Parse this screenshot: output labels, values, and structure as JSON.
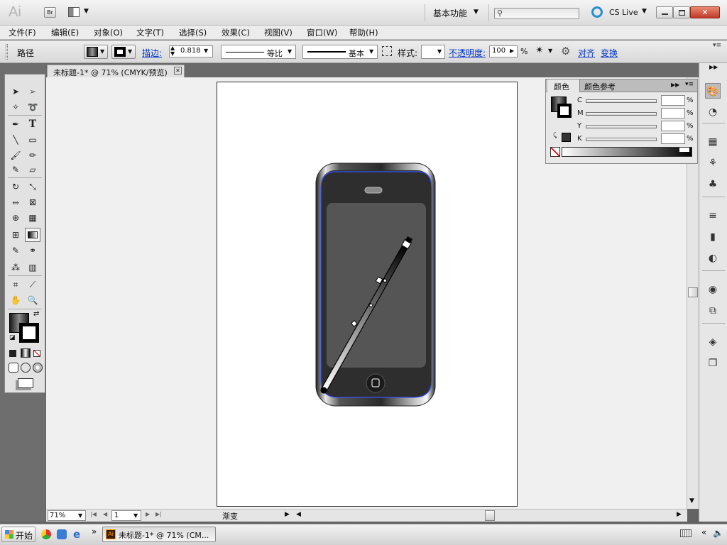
{
  "app": {
    "logo": "Ai",
    "bridge": "Br",
    "workspace": "基本功能",
    "cslive": "CS Live",
    "search_value": ""
  },
  "menu": [
    "文件(F)",
    "编辑(E)",
    "对象(O)",
    "文字(T)",
    "选择(S)",
    "效果(C)",
    "视图(V)",
    "窗口(W)",
    "帮助(H)"
  ],
  "control": {
    "selection_label": "路径",
    "stroke_label": "描边:",
    "stroke_value": "0.818",
    "stroke_profile": "等比",
    "brush": "基本",
    "style_label": "样式:",
    "opacity_label": "不透明度:",
    "opacity_value": "100",
    "opacity_unit": "%",
    "align": "对齐",
    "transform": "变换"
  },
  "document": {
    "tab_title": "未标题-1* @ 71% (CMYK/预览)"
  },
  "status": {
    "zoom": "71%",
    "artboard": "1",
    "info": "渐变"
  },
  "color_panel": {
    "tab_color": "颜色",
    "tab_guide": "颜色参考",
    "channels": [
      {
        "label": "C",
        "value": "",
        "unit": "%"
      },
      {
        "label": "M",
        "value": "",
        "unit": "%"
      },
      {
        "label": "Y",
        "value": "",
        "unit": "%"
      },
      {
        "label": "K",
        "value": "",
        "unit": "%"
      }
    ]
  },
  "taskbar": {
    "start": "开始",
    "app_button": "未标题-1* @ 71% (CM..."
  },
  "colors": {
    "accent": "#0033cc",
    "panel_dark": "#636363",
    "selection_blue": "#3355ff"
  }
}
